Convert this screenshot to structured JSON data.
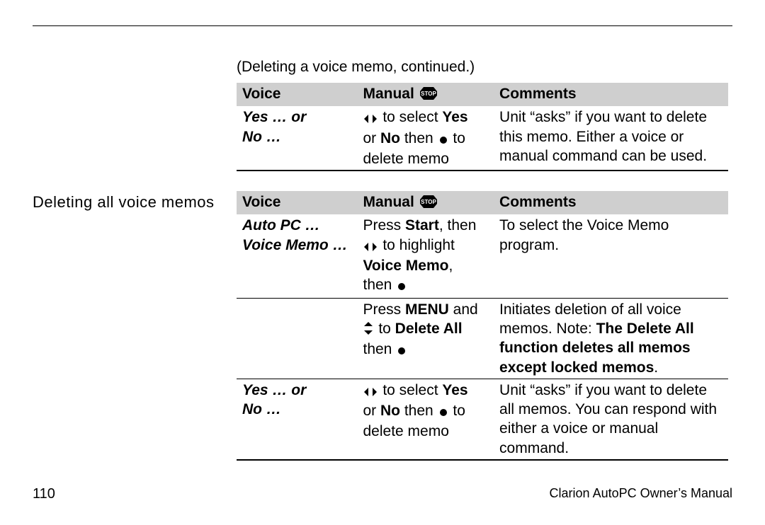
{
  "continued_caption": "(Deleting a voice memo, continued.)",
  "table1": {
    "headers": {
      "voice": "Voice",
      "manual": "Manual",
      "comments": "Comments"
    },
    "rows": [
      {
        "voice_lines": [
          "Yes … or",
          "No …"
        ],
        "manual": {
          "pre_icon": "lr",
          "line1_after": " to select ",
          "line1_bold": "Yes",
          "line2_pre": "or ",
          "line2_bold": "No",
          "line2_mid": " then ",
          "line2_icon": "enter",
          "line2_after": " to",
          "line3": "delete memo"
        },
        "comments": "Unit “asks” if you want to delete this memo.  Either a voice or manual command can be used."
      }
    ]
  },
  "section2_heading": "Deleting all voice memos",
  "table2": {
    "headers": {
      "voice": "Voice",
      "manual": "Manual",
      "comments": "Comments"
    },
    "rows": [
      {
        "voice_lines": [
          "Auto PC …",
          "Voice Memo …"
        ],
        "manual": {
          "l1_pre": "Press ",
          "l1_bold": "Start",
          "l1_post": ", then",
          "l2_icon": "lr",
          "l2_post": " to highlight",
          "l3_bold": "Voice Memo",
          "l3_post": ",",
          "l4_pre": "then ",
          "l4_icon": "enter"
        },
        "comments": "To select the Voice Memo program."
      },
      {
        "voice_lines": [],
        "manual": {
          "l1_pre": "Press ",
          "l1_bold": "MENU",
          "l1_post": " and",
          "l2_icon": "ud",
          "l2_mid": " to ",
          "l2_bold": "Delete All",
          "l3_pre": "then ",
          "l3_icon": "enter"
        },
        "comments_pre": "Initiates deletion of all voice memos.  Note: ",
        "comments_bold": "The Delete All function deletes all memos except locked memos",
        "comments_post": "."
      },
      {
        "voice_lines": [
          "Yes … or",
          "No …"
        ],
        "manual": {
          "pre_icon": "lr",
          "line1_after": " to select ",
          "line1_bold": "Yes",
          "line2_pre": "or ",
          "line2_bold": "No",
          "line2_mid": " then ",
          "line2_icon": "enter",
          "line2_after": " to",
          "line3": "delete memo"
        },
        "comments": "Unit “asks” if you want to delete all memos.  You can respond with either a voice or manual command."
      }
    ]
  },
  "footer": {
    "page_number": "110",
    "manual_title": "Clarion AutoPC Owner’s Manual"
  },
  "icons": {
    "stop_label": "STOP"
  }
}
